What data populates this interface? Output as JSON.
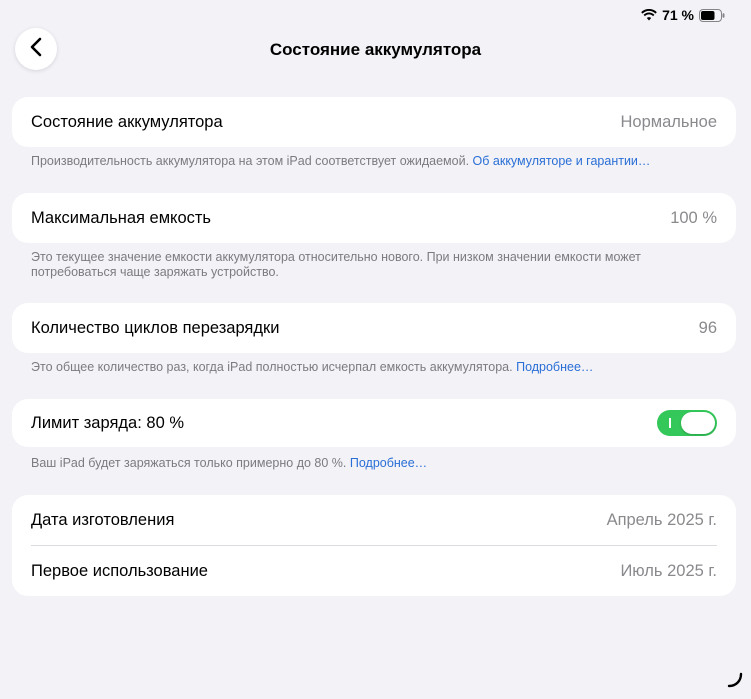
{
  "status": {
    "battery_percent": "71 %",
    "battery_level": 0.71
  },
  "header": {
    "title": "Состояние аккумулятора",
    "back_icon": "chevron-left-icon"
  },
  "sections": {
    "health": {
      "label": "Состояние аккумулятора",
      "value": "Нормальное",
      "footnote": "Производительность аккумулятора на этом iPad соответствует ожидаемой.",
      "link": "Об аккумуляторе и гарантии…"
    },
    "capacity": {
      "label": "Максимальная емкость",
      "value": "100 %",
      "footnote_line1": "Это текущее значение емкости аккумулятора относительно нового. При низком значении емкости может",
      "footnote_line2": "потребоваться чаще заряжать устройство."
    },
    "cycles": {
      "label": "Количество циклов перезарядки",
      "value": "96",
      "footnote": "Это общее количество раз, когда iPad полностью исчерпал емкость аккумулятора.",
      "link": "Подробнее…"
    },
    "limit": {
      "label": "Лимит заряда: 80 %",
      "toggle_on": true,
      "footnote": "Ваш iPad будет заряжаться только примерно до 80 %.",
      "link": "Подробнее…"
    },
    "dates": {
      "manufacture_label": "Дата изготовления",
      "manufacture_value": "Апрель 2025 г.",
      "first_use_label": "Первое использование",
      "first_use_value": "Июль 2025 г."
    }
  },
  "colors": {
    "background": "#f2f2f7",
    "toggle_on": "#34c759",
    "link": "#2a6fd6"
  }
}
